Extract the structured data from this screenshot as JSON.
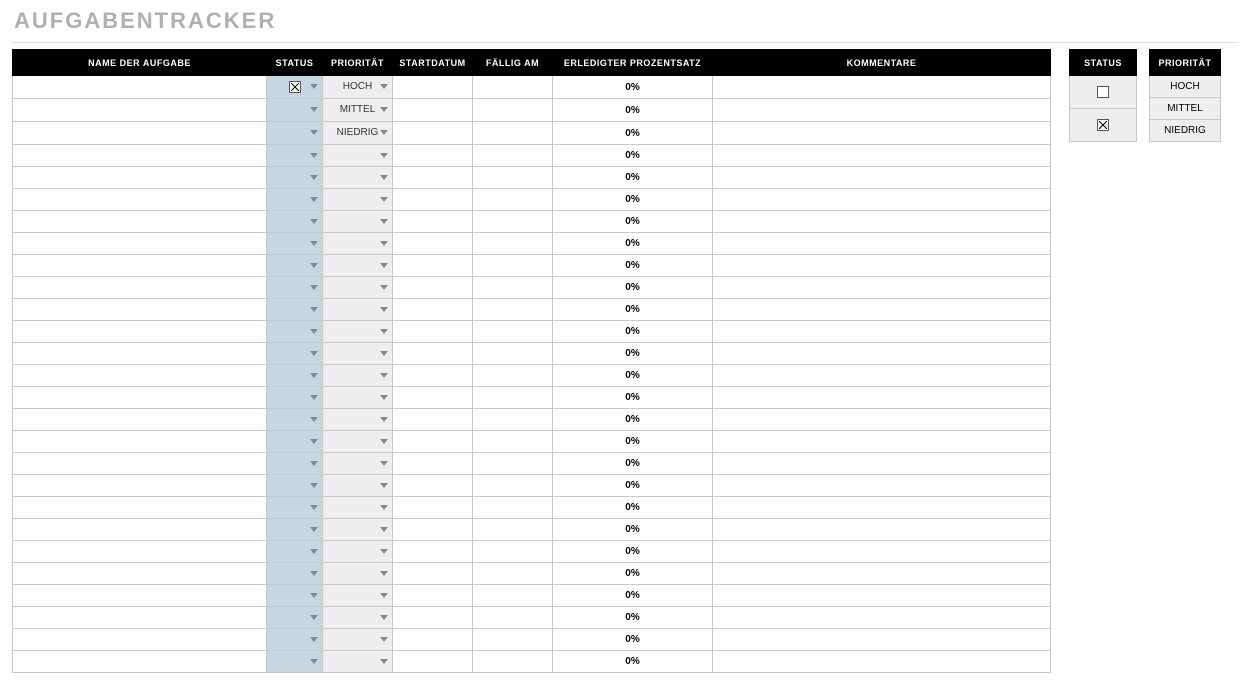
{
  "title": "AUFGABENTRACKER",
  "columns": {
    "name": "NAME DER AUFGABE",
    "status": "STATUS",
    "priority": "PRIORITÄT",
    "start": "STARTDATUM",
    "due": "FÄLLIG AM",
    "done": "ERLEDIGTER PROZENTSATZ",
    "comments": "KOMMENTARE"
  },
  "priority_options": [
    "HOCH",
    "MITTEL",
    "NIEDRIG"
  ],
  "rows": [
    {
      "name": "",
      "status_checked": true,
      "priority": "HOCH",
      "start": "",
      "due": "",
      "done": "0%",
      "comments": ""
    },
    {
      "name": "",
      "status_checked": false,
      "priority": "MITTEL",
      "start": "",
      "due": "",
      "done": "0%",
      "comments": ""
    },
    {
      "name": "",
      "status_checked": false,
      "priority": "NIEDRIG",
      "start": "",
      "due": "",
      "done": "0%",
      "comments": ""
    },
    {
      "name": "",
      "status_checked": false,
      "priority": "",
      "start": "",
      "due": "",
      "done": "0%",
      "comments": ""
    },
    {
      "name": "",
      "status_checked": false,
      "priority": "",
      "start": "",
      "due": "",
      "done": "0%",
      "comments": ""
    },
    {
      "name": "",
      "status_checked": false,
      "priority": "",
      "start": "",
      "due": "",
      "done": "0%",
      "comments": ""
    },
    {
      "name": "",
      "status_checked": false,
      "priority": "",
      "start": "",
      "due": "",
      "done": "0%",
      "comments": ""
    },
    {
      "name": "",
      "status_checked": false,
      "priority": "",
      "start": "",
      "due": "",
      "done": "0%",
      "comments": ""
    },
    {
      "name": "",
      "status_checked": false,
      "priority": "",
      "start": "",
      "due": "",
      "done": "0%",
      "comments": ""
    },
    {
      "name": "",
      "status_checked": false,
      "priority": "",
      "start": "",
      "due": "",
      "done": "0%",
      "comments": ""
    },
    {
      "name": "",
      "status_checked": false,
      "priority": "",
      "start": "",
      "due": "",
      "done": "0%",
      "comments": ""
    },
    {
      "name": "",
      "status_checked": false,
      "priority": "",
      "start": "",
      "due": "",
      "done": "0%",
      "comments": ""
    },
    {
      "name": "",
      "status_checked": false,
      "priority": "",
      "start": "",
      "due": "",
      "done": "0%",
      "comments": ""
    },
    {
      "name": "",
      "status_checked": false,
      "priority": "",
      "start": "",
      "due": "",
      "done": "0%",
      "comments": ""
    },
    {
      "name": "",
      "status_checked": false,
      "priority": "",
      "start": "",
      "due": "",
      "done": "0%",
      "comments": ""
    },
    {
      "name": "",
      "status_checked": false,
      "priority": "",
      "start": "",
      "due": "",
      "done": "0%",
      "comments": ""
    },
    {
      "name": "",
      "status_checked": false,
      "priority": "",
      "start": "",
      "due": "",
      "done": "0%",
      "comments": ""
    },
    {
      "name": "",
      "status_checked": false,
      "priority": "",
      "start": "",
      "due": "",
      "done": "0%",
      "comments": ""
    },
    {
      "name": "",
      "status_checked": false,
      "priority": "",
      "start": "",
      "due": "",
      "done": "0%",
      "comments": ""
    },
    {
      "name": "",
      "status_checked": false,
      "priority": "",
      "start": "",
      "due": "",
      "done": "0%",
      "comments": ""
    },
    {
      "name": "",
      "status_checked": false,
      "priority": "",
      "start": "",
      "due": "",
      "done": "0%",
      "comments": ""
    },
    {
      "name": "",
      "status_checked": false,
      "priority": "",
      "start": "",
      "due": "",
      "done": "0%",
      "comments": ""
    },
    {
      "name": "",
      "status_checked": false,
      "priority": "",
      "start": "",
      "due": "",
      "done": "0%",
      "comments": ""
    },
    {
      "name": "",
      "status_checked": false,
      "priority": "",
      "start": "",
      "due": "",
      "done": "0%",
      "comments": ""
    },
    {
      "name": "",
      "status_checked": false,
      "priority": "",
      "start": "",
      "due": "",
      "done": "0%",
      "comments": ""
    },
    {
      "name": "",
      "status_checked": false,
      "priority": "",
      "start": "",
      "due": "",
      "done": "0%",
      "comments": ""
    },
    {
      "name": "",
      "status_checked": false,
      "priority": "",
      "start": "",
      "due": "",
      "done": "0%",
      "comments": ""
    }
  ],
  "legend": {
    "status": {
      "header": "STATUS",
      "items": [
        {
          "checked": false
        },
        {
          "checked": true
        }
      ]
    },
    "priority": {
      "header": "PRIORITÄT",
      "items": [
        "HOCH",
        "MITTEL",
        "NIEDRIG"
      ]
    }
  }
}
